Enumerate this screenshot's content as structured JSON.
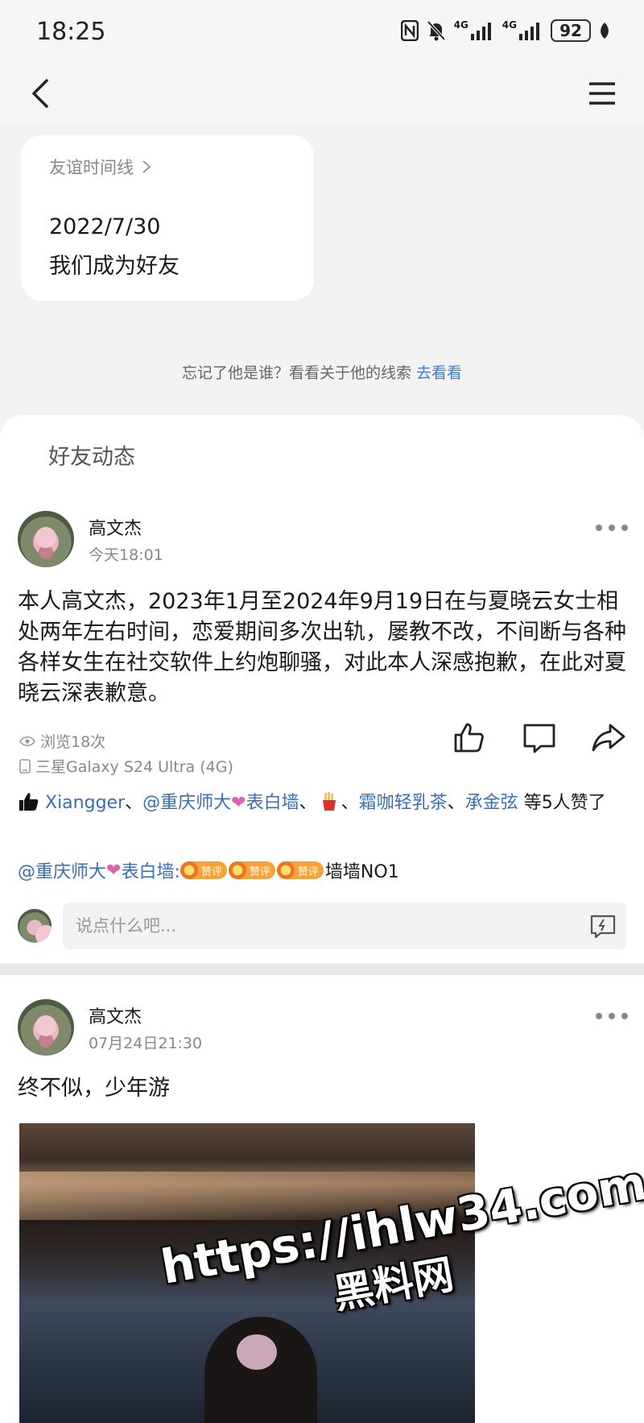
{
  "status_bar": {
    "time": "18:25",
    "battery": "92",
    "network_labels": [
      "4G",
      "4G"
    ]
  },
  "timeline": {
    "link_label": "友谊时间线",
    "date": "2022/7/30",
    "description": "我们成为好友"
  },
  "hint": {
    "text": "忘记了他是谁？看看关于他的线索",
    "link": "去看看"
  },
  "feed": {
    "title": "好友动态",
    "posts": [
      {
        "name": "高文杰",
        "time": "今天18:01",
        "body": "本人高文杰，2023年1月至2024年9月19日在与夏晓云女士相处两年左右时间，恋爱期间多次出轨，屡教不改，不间断与各种各样女生在社交软件上约炮聊骚，对此本人深感抱歉，在此对夏晓云深表歉意。",
        "views": "浏览18次",
        "device": "三星Galaxy S24 Ultra (4G)",
        "likes": {
          "name1": "Xiangger",
          "sep": "、",
          "name2a": "@重庆师大",
          "name2b": "表白墙",
          "name3": "霜咖轻乳茶",
          "name4": "承金弦",
          "suffix": "等5人赞了"
        },
        "comment": {
          "author_a": "@重庆师大",
          "author_b": "表白墙:",
          "badge_label": "赞评",
          "text": "墙墙NO1"
        },
        "input_placeholder": "说点什么吧..."
      },
      {
        "name": "高文杰",
        "time": "07月24日21:30",
        "body": "终不似，少年游"
      }
    ]
  },
  "watermark": {
    "url": "https://ihlw34.com",
    "name": "黑料网"
  },
  "colors": {
    "link_blue": "#3a6fb0",
    "background": "#f3f3f3",
    "card": "#ffffff"
  }
}
